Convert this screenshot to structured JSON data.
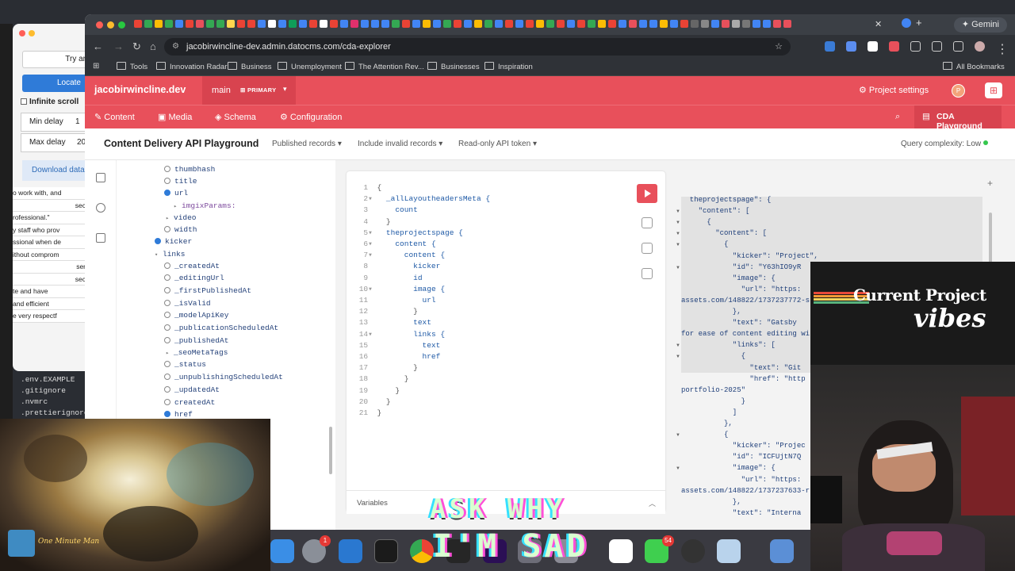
{
  "left_window": {
    "buttons": [
      "Try ar",
      "Locate"
    ],
    "infinite_scroll_label": "Infinite scroll",
    "min_delay_label": "Min delay",
    "min_delay_value": "1",
    "max_delay_label": "Max delay",
    "max_delay_value": "20",
    "download_label": "Download data",
    "close_symbol": "×",
    "text_rows": [
      "o work with, and",
      "sec",
      "rofessional.\"",
      "y staff who prov",
      "ssional when de",
      "ithout comprom",
      "ser",
      "sec",
      "te and have",
      "and efficient",
      "e very respectf"
    ],
    "files": [
      ".env.EXAMPLE",
      ".gitignore",
      ".nvmrc",
      ".prettierignore"
    ]
  },
  "browser": {
    "gemini_label": "Gemini",
    "url": "jacobirwincline-dev.admin.datocms.com/cda-explorer",
    "bookmarks": [
      "Tools",
      "Innovation Radar",
      "Business",
      "Unemployment",
      "The Attention Rev...",
      "Businesses",
      "Inspiration"
    ],
    "all_bookmarks": "All Bookmarks"
  },
  "dato": {
    "site_name": "jacobirwincline.dev",
    "environment": "main",
    "environment_badge": "PRIMARY",
    "project_settings": "Project settings",
    "avatar_initial": "P",
    "nav": [
      "Content",
      "Media",
      "Schema",
      "Configuration"
    ],
    "cda_tab": "CDA Playground"
  },
  "playground": {
    "title": "Content Delivery API Playground",
    "dropdowns": [
      "Published records",
      "Include invalid records",
      "Read-only API token"
    ],
    "complexity": "Query complexity: Low",
    "variables_label": "Variables"
  },
  "explorer": {
    "fields": [
      {
        "name": "thumbhash",
        "checked": false
      },
      {
        "name": "title",
        "checked": false
      },
      {
        "name": "url",
        "checked": true
      },
      {
        "name": "imgixParams:",
        "sub": true
      },
      {
        "name": "video",
        "expandable": true
      },
      {
        "name": "width",
        "checked": false
      },
      {
        "name": "kicker",
        "checked": true
      },
      {
        "name": "links",
        "expandable": true,
        "open": true
      },
      {
        "name": "_createdAt",
        "checked": false
      },
      {
        "name": "_editingUrl",
        "checked": false
      },
      {
        "name": "_firstPublishedAt",
        "checked": false
      },
      {
        "name": "_isValid",
        "checked": false
      },
      {
        "name": "_modelApiKey",
        "checked": false
      },
      {
        "name": "_publicationScheduledAt",
        "checked": false
      },
      {
        "name": "_publishedAt",
        "checked": false
      },
      {
        "name": "_seoMetaTags",
        "expandable": true
      },
      {
        "name": "_status",
        "checked": false
      },
      {
        "name": "_unpublishingScheduledAt",
        "checked": false
      },
      {
        "name": "_updatedAt",
        "checked": false
      },
      {
        "name": "createdAt",
        "checked": false
      },
      {
        "name": "href",
        "checked": true
      }
    ]
  },
  "query": {
    "lines": [
      "{",
      "  _allLayoutheadersMeta {",
      "    count",
      "  }",
      "  theprojectspage {",
      "    content {",
      "      content {",
      "        kicker",
      "        id",
      "        image {",
      "          url",
      "        }",
      "        text",
      "        links {",
      "          text",
      "          href",
      "        }",
      "      }",
      "    }",
      "  }",
      "}"
    ]
  },
  "result": {
    "lines": [
      "  theprojectspage\": {",
      "    \"content\": [",
      "      {",
      "        \"content\": [",
      "          {",
      "            \"kicker\": \"Project\",",
      "            \"id\": \"Y63hIO9yR",
      "            \"image\": {",
      "              \"url\": \"https:",
      "assets.com/148822/1737237772-s",
      "            },",
      "            \"text\": \"Gatsby",
      "for ease of content editing wi",
      "            \"links\": [",
      "              {",
      "                \"text\": \"Git",
      "                \"href\": \"http",
      "portfolio-2025\"",
      "              }",
      "            ]",
      "          },",
      "          {",
      "            \"kicker\": \"Projec",
      "            \"id\": \"ICFUjtN7Q",
      "            \"image\": {",
      "              \"url\": \"https:",
      "assets.com/148822/1737237633-r",
      "            },",
      "            \"text\": \"Interna"
    ]
  },
  "overlays": {
    "title_line1": "Current Project",
    "title_line2": "vibes",
    "camera_sign": "One Minute Man",
    "ask_why": "ASK WHY",
    "im_sad": "I'M SAD",
    "dock_badges": [
      "1",
      "54"
    ]
  }
}
